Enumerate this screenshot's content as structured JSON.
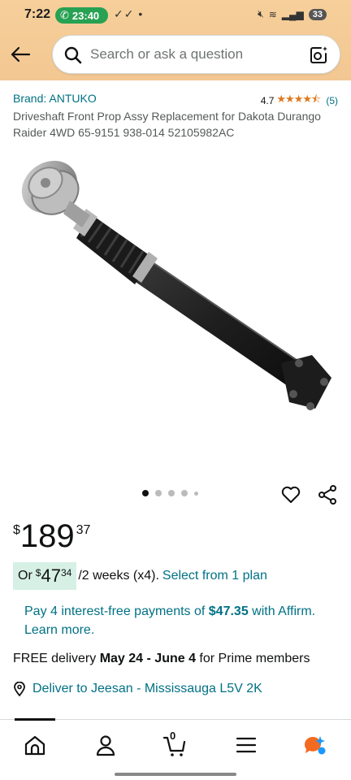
{
  "status_bar": {
    "time": "7:22",
    "call_duration": "23:40",
    "checks": "✓✓ •",
    "battery": "33"
  },
  "search": {
    "placeholder": "Search or ask a question"
  },
  "product": {
    "brand": "Brand: ANTUKO",
    "rating": "4.7",
    "stars": "★★★★⯪",
    "review_count": "(5)",
    "title": "Driveshaft Front Prop Assy Replacement for Dakota Durango Raider 4WD 65-9151 938-014 52105982AC",
    "image_count": 5,
    "active_image": 0
  },
  "price": {
    "currency": "$",
    "whole": "189",
    "fraction": "37"
  },
  "plan": {
    "prefix": "Or",
    "currency": "$",
    "whole": "47",
    "fraction": "34",
    "rest": "/2 weeks (x4).",
    "link": "Select from 1 plan"
  },
  "affirm": {
    "text_before": "Pay 4 interest-free payments of ",
    "amount": "$47.35",
    "text_after": " with Affirm. Learn more."
  },
  "delivery": {
    "prefix": "FREE delivery ",
    "dates": "May 24 - June 4",
    "suffix": " for Prime members"
  },
  "deliver_to": {
    "label": "Deliver to Jeesan - Mississauga L5V 2K"
  },
  "bottom_nav": {
    "cart_count": "0"
  },
  "colors": {
    "header_bg": "#f3c792",
    "link": "#007185",
    "star": "#de7921",
    "plan_bg": "#d6f0e6"
  }
}
